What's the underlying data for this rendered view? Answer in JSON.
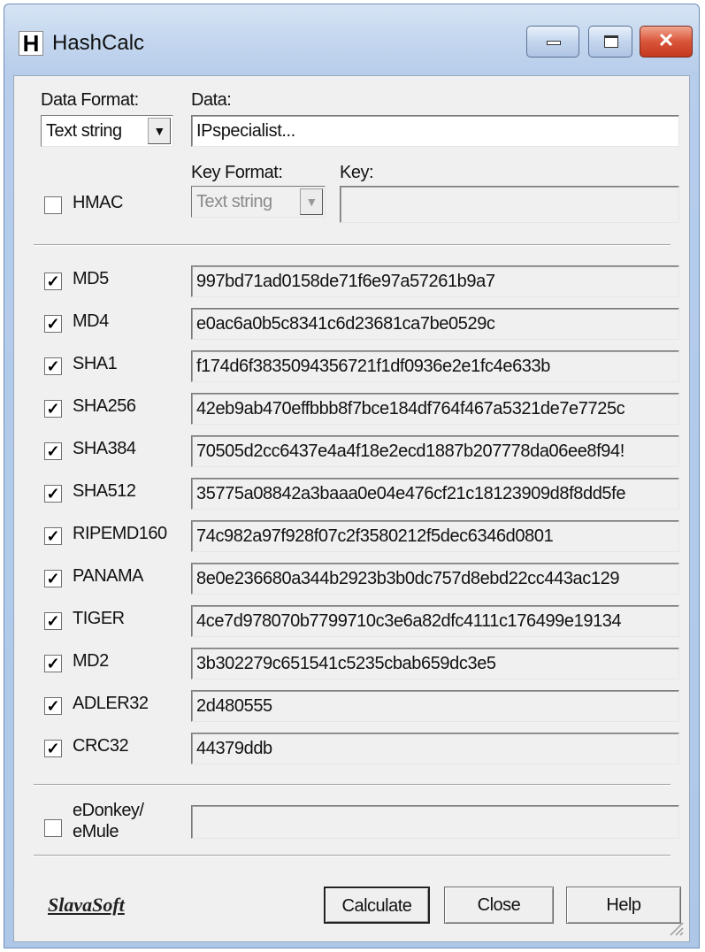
{
  "window": {
    "title": "HashCalc",
    "app_icon": "H"
  },
  "input": {
    "data_format_label": "Data Format:",
    "data_format_value": "Text string",
    "data_label": "Data:",
    "data_value": "IPspecialist..."
  },
  "hmac": {
    "label": "HMAC",
    "checked": false,
    "key_format_label": "Key Format:",
    "key_format_value": "Text string",
    "key_label": "Key:",
    "key_value": ""
  },
  "hashes": [
    {
      "label": "MD5",
      "checked": true,
      "value": "997bd71ad0158de71f6e97a57261b9a7"
    },
    {
      "label": "MD4",
      "checked": true,
      "value": "e0ac6a0b5c8341c6d23681ca7be0529c"
    },
    {
      "label": "SHA1",
      "checked": true,
      "value": "f174d6f3835094356721f1df0936e2e1fc4e633b"
    },
    {
      "label": "SHA256",
      "checked": true,
      "value": "42eb9ab470effbbb8f7bce184df764f467a5321de7e7725c"
    },
    {
      "label": "SHA384",
      "checked": true,
      "value": "70505d2cc6437e4a4f18e2ecd1887b207778da06ee8f94!"
    },
    {
      "label": "SHA512",
      "checked": true,
      "value": "35775a08842a3baaa0e04e476cf21c18123909d8f8dd5fe"
    },
    {
      "label": "RIPEMD160",
      "checked": true,
      "value": "74c982a97f928f07c2f3580212f5dec6346d0801"
    },
    {
      "label": "PANAMA",
      "checked": true,
      "value": "8e0e236680a344b2923b3b0dc757d8ebd22cc443ac129"
    },
    {
      "label": "TIGER",
      "checked": true,
      "value": "4ce7d978070b7799710c3e6a82dfc4111c176499e19134"
    },
    {
      "label": "MD2",
      "checked": true,
      "value": "3b302279c651541c5235cbab659dc3e5"
    },
    {
      "label": "ADLER32",
      "checked": true,
      "value": "2d480555"
    },
    {
      "label": "CRC32",
      "checked": true,
      "value": "44379ddb"
    }
  ],
  "edonkey": {
    "label_line1": "eDonkey/",
    "label_line2": "eMule",
    "checked": false,
    "value": ""
  },
  "footer": {
    "brand": "SlavaSoft",
    "calculate_label": "Calculate",
    "close_label": "Close",
    "help_label": "Help"
  },
  "glyphs": {
    "check": "✓",
    "dropdown": "▼",
    "close": "✕"
  }
}
